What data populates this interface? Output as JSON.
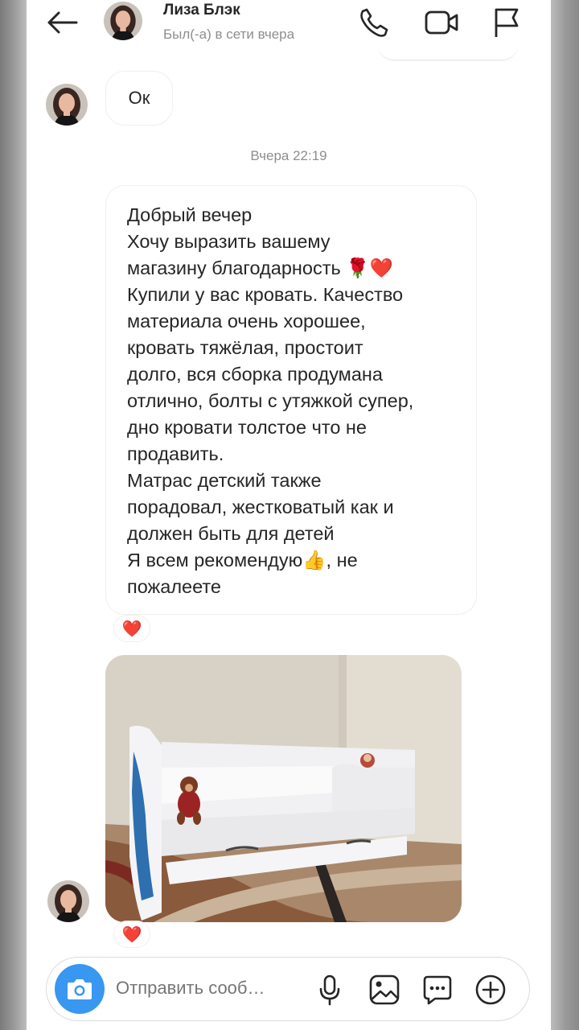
{
  "header": {
    "contact_name": "Лиза Блэк",
    "status": "Был(-а) в сети вчера",
    "icons": [
      "back-arrow-icon",
      "phone-icon",
      "video-icon",
      "flag-icon"
    ]
  },
  "messages": {
    "ok_text": "Ок",
    "timestamp": "Вчера 22:19",
    "review_lines": [
      "Добрый вечер",
      "Хочу выразить вашему",
      "магазину благодарность 🌹❤️",
      "Купили у вас кровать. Качество",
      "материала очень хорошее,",
      "кровать тяжёлая, простоит",
      "долго, вся сборка продумана",
      "отлично, болты с утяжкой супер,",
      "дно кровати толстое что не",
      "продавить.",
      "Матрас детский также",
      "порадовал, жестковатый как и",
      "должен быть для детей",
      "Я всем рекомендую👍, не",
      "пожалеете"
    ],
    "reaction": "❤️"
  },
  "composer": {
    "placeholder": "Отправить сооб…",
    "icons": [
      "camera-icon",
      "microphone-icon",
      "gallery-icon",
      "sticker-icon",
      "plus-icon"
    ]
  },
  "colors": {
    "accent": "#3897f0",
    "text": "#262626",
    "secondary": "#8e8e8e",
    "border": "#efefef"
  }
}
